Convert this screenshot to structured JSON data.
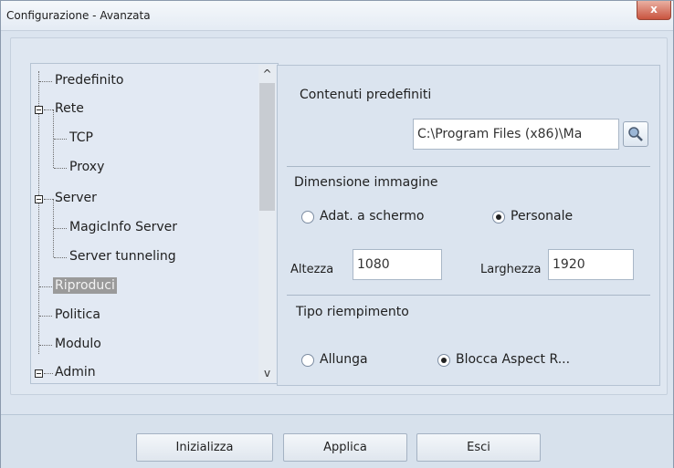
{
  "window": {
    "title": "Configurazione - Avanzata",
    "close_glyph": "x"
  },
  "tree": {
    "items": [
      {
        "label": "Predefinito"
      },
      {
        "label": "Rete"
      },
      {
        "label": "TCP"
      },
      {
        "label": "Proxy"
      },
      {
        "label": "Server"
      },
      {
        "label": "MagicInfo Server"
      },
      {
        "label": "Server tunneling"
      },
      {
        "label": "Riproduci"
      },
      {
        "label": "Politica"
      },
      {
        "label": "Modulo"
      },
      {
        "label": "Admin"
      }
    ],
    "scroll_up": "^",
    "scroll_down": "v"
  },
  "panel": {
    "default_content": {
      "label": "Contenuti predefiniti",
      "path": "C:\\Program Files (x86)\\Ma",
      "search_icon": "magnifier-icon"
    },
    "image_size": {
      "label": "Dimensione immagine",
      "option_fit": "Adat. a schermo",
      "option_custom": "Personale",
      "selected": "Personale",
      "height_label": "Altezza",
      "height_value": "1080",
      "width_label": "Larghezza",
      "width_value": "1920"
    },
    "fill_type": {
      "label": "Tipo riempimento",
      "option_stretch": "Allunga",
      "option_lock": "Blocca Aspect R...",
      "selected": "Blocca Aspect R..."
    }
  },
  "buttons": {
    "reset": "Inizializza",
    "apply": "Applica",
    "exit": "Esci"
  },
  "colors": {
    "background": "#dbe4ef",
    "selected_item": "#9a9a9a",
    "close_button": "#c9543f"
  }
}
